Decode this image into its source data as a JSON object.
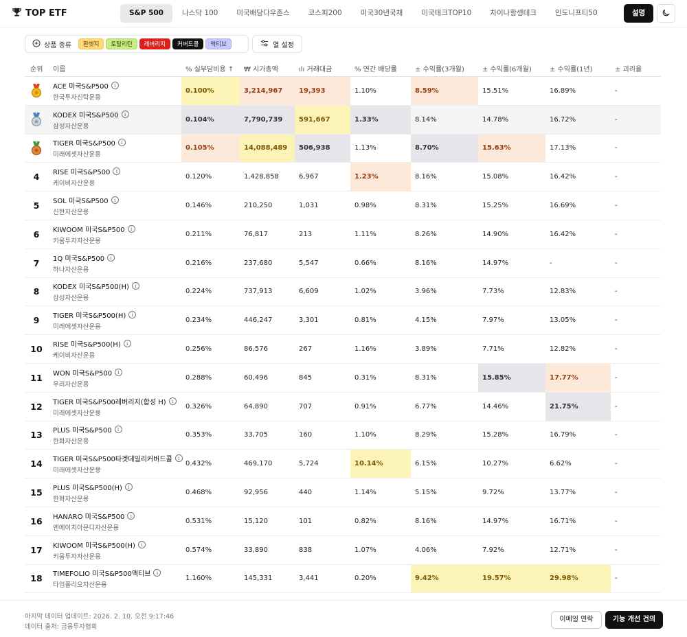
{
  "header": {
    "logo_text": "TOP ETF",
    "tabs": [
      {
        "label": "S&P 500",
        "active": true
      },
      {
        "label": "나스닥 100"
      },
      {
        "label": "미국배당다우존스"
      },
      {
        "label": "코스피200"
      },
      {
        "label": "미국30년국채"
      },
      {
        "label": "미국테크TOP10"
      },
      {
        "label": "차이나항셍테크"
      },
      {
        "label": "인도니프티50"
      }
    ],
    "explain_label": "설명",
    "theme_icon": "moon-icon"
  },
  "filters": {
    "label": "상품 종류",
    "chips": [
      "환헷지",
      "토탈리턴",
      "레버리지",
      "커버드콜",
      "액티브"
    ],
    "column_settings_label": "열 설정"
  },
  "table": {
    "columns": {
      "rank": "순위",
      "name": "이름",
      "expense": "% 실부담비용 ↑",
      "marketcap": "₩ 시가총액",
      "volume": "ılı 거래대금",
      "dividend": "% 연간 배당률",
      "r3m": "± 수익률(3개월)",
      "r6m": "± 수익률(6개월)",
      "r1y": "± 수익률(1년)",
      "gap": "± 괴리율"
    },
    "rows": [
      {
        "rank": "1",
        "medal": "gold",
        "name": "ACE 미국S&P500",
        "company": "한국투자신탁운용",
        "expense": "0.100%",
        "marketcap": "3,214,967",
        "volume": "19,393",
        "dividend": "1.10%",
        "r3m": "8.59%",
        "r6m": "15.51%",
        "r1y": "16.89%",
        "gap": "-"
      },
      {
        "rank": "2",
        "medal": "silver",
        "name": "KODEX 미국S&P500",
        "company": "삼성자산운용",
        "expense": "0.104%",
        "marketcap": "7,790,739",
        "volume": "591,667",
        "dividend": "1.33%",
        "r3m": "8.14%",
        "r6m": "14.78%",
        "r1y": "16.72%",
        "gap": "-"
      },
      {
        "rank": "3",
        "medal": "bronze",
        "name": "TIGER 미국S&P500",
        "company": "미래에셋자산운용",
        "expense": "0.105%",
        "marketcap": "14,088,489",
        "volume": "506,938",
        "dividend": "1.13%",
        "r3m": "8.70%",
        "r6m": "15.63%",
        "r1y": "17.13%",
        "gap": "-"
      },
      {
        "rank": "4",
        "name": "RISE 미국S&P500",
        "company": "케이비자산운용",
        "expense": "0.120%",
        "marketcap": "1,428,858",
        "volume": "6,967",
        "dividend": "1.23%",
        "r3m": "8.16%",
        "r6m": "15.08%",
        "r1y": "16.42%",
        "gap": "-"
      },
      {
        "rank": "5",
        "name": "SOL 미국S&P500",
        "company": "신한자산운용",
        "expense": "0.146%",
        "marketcap": "210,250",
        "volume": "1,031",
        "dividend": "0.98%",
        "r3m": "8.31%",
        "r6m": "15.25%",
        "r1y": "16.69%",
        "gap": "-"
      },
      {
        "rank": "6",
        "name": "KIWOOM 미국S&P500",
        "company": "키움투자자산운용",
        "expense": "0.211%",
        "marketcap": "76,817",
        "volume": "213",
        "dividend": "1.11%",
        "r3m": "8.26%",
        "r6m": "14.90%",
        "r1y": "16.42%",
        "gap": "-"
      },
      {
        "rank": "7",
        "name": "1Q 미국S&P500",
        "company": "하나자산운용",
        "expense": "0.216%",
        "marketcap": "237,680",
        "volume": "5,547",
        "dividend": "0.66%",
        "r3m": "8.16%",
        "r6m": "14.97%",
        "r1y": "-",
        "gap": "-"
      },
      {
        "rank": "8",
        "name": "KODEX 미국S&P500(H)",
        "company": "삼성자산운용",
        "expense": "0.224%",
        "marketcap": "737,913",
        "volume": "6,609",
        "dividend": "1.02%",
        "r3m": "3.96%",
        "r6m": "7.73%",
        "r1y": "12.83%",
        "gap": "-"
      },
      {
        "rank": "9",
        "name": "TIGER 미국S&P500(H)",
        "company": "미래에셋자산운용",
        "expense": "0.234%",
        "marketcap": "446,247",
        "volume": "3,301",
        "dividend": "0.81%",
        "r3m": "4.15%",
        "r6m": "7.97%",
        "r1y": "13.05%",
        "gap": "-"
      },
      {
        "rank": "10",
        "name": "RISE 미국S&P500(H)",
        "company": "케이비자산운용",
        "expense": "0.256%",
        "marketcap": "86,576",
        "volume": "267",
        "dividend": "1.16%",
        "r3m": "3.89%",
        "r6m": "7.71%",
        "r1y": "12.82%",
        "gap": "-"
      },
      {
        "rank": "11",
        "name": "WON 미국S&P500",
        "company": "우리자산운용",
        "expense": "0.288%",
        "marketcap": "60,496",
        "volume": "845",
        "dividend": "0.31%",
        "r3m": "8.31%",
        "r6m": "15.85%",
        "r1y": "17.77%",
        "gap": "-"
      },
      {
        "rank": "12",
        "name": "TIGER 미국S&P500레버리지(합성 H)",
        "company": "미래에셋자산운용",
        "expense": "0.326%",
        "marketcap": "64,890",
        "volume": "707",
        "dividend": "0.91%",
        "r3m": "6.77%",
        "r6m": "14.46%",
        "r1y": "21.75%",
        "gap": "-"
      },
      {
        "rank": "13",
        "name": "PLUS 미국S&P500",
        "company": "한화자산운용",
        "expense": "0.353%",
        "marketcap": "33,705",
        "volume": "160",
        "dividend": "1.10%",
        "r3m": "8.29%",
        "r6m": "15.28%",
        "r1y": "16.79%",
        "gap": "-"
      },
      {
        "rank": "14",
        "name": "TIGER 미국S&P500타겟데일리커버드콜",
        "company": "미래에셋자산운용",
        "expense": "0.432%",
        "marketcap": "469,170",
        "volume": "5,724",
        "dividend": "10.14%",
        "r3m": "6.15%",
        "r6m": "10.27%",
        "r1y": "6.62%",
        "gap": "-"
      },
      {
        "rank": "15",
        "name": "PLUS 미국S&P500(H)",
        "company": "한화자산운용",
        "expense": "0.468%",
        "marketcap": "92,956",
        "volume": "440",
        "dividend": "1.14%",
        "r3m": "5.15%",
        "r6m": "9.72%",
        "r1y": "13.77%",
        "gap": "-"
      },
      {
        "rank": "16",
        "name": "HANARO 미국S&P500",
        "company": "엔에이치아문디자산운용",
        "expense": "0.531%",
        "marketcap": "15,120",
        "volume": "101",
        "dividend": "0.82%",
        "r3m": "8.16%",
        "r6m": "14.97%",
        "r1y": "16.71%",
        "gap": "-"
      },
      {
        "rank": "17",
        "name": "KIWOOM 미국S&P500(H)",
        "company": "키움투자자산운용",
        "expense": "0.574%",
        "marketcap": "33,890",
        "volume": "838",
        "dividend": "1.07%",
        "r3m": "4.06%",
        "r6m": "7.92%",
        "r1y": "12.71%",
        "gap": "-"
      },
      {
        "rank": "18",
        "name": "TIMEFOLIO 미국S&P500액티브",
        "company": "타임폴리오자산운용",
        "expense": "1.160%",
        "marketcap": "145,331",
        "volume": "3,441",
        "dividend": "0.20%",
        "r3m": "9.42%",
        "r6m": "19.57%",
        "r1y": "29.98%",
        "gap": "-"
      }
    ]
  },
  "footer": {
    "updated": "마지막 데이터 업데이트: 2026. 2. 10. 오전 9:17:46",
    "source": "데이터 출처: 금융투자협회",
    "email_label": "이메일 연락",
    "suggest_label": "기능 개선 건의"
  }
}
